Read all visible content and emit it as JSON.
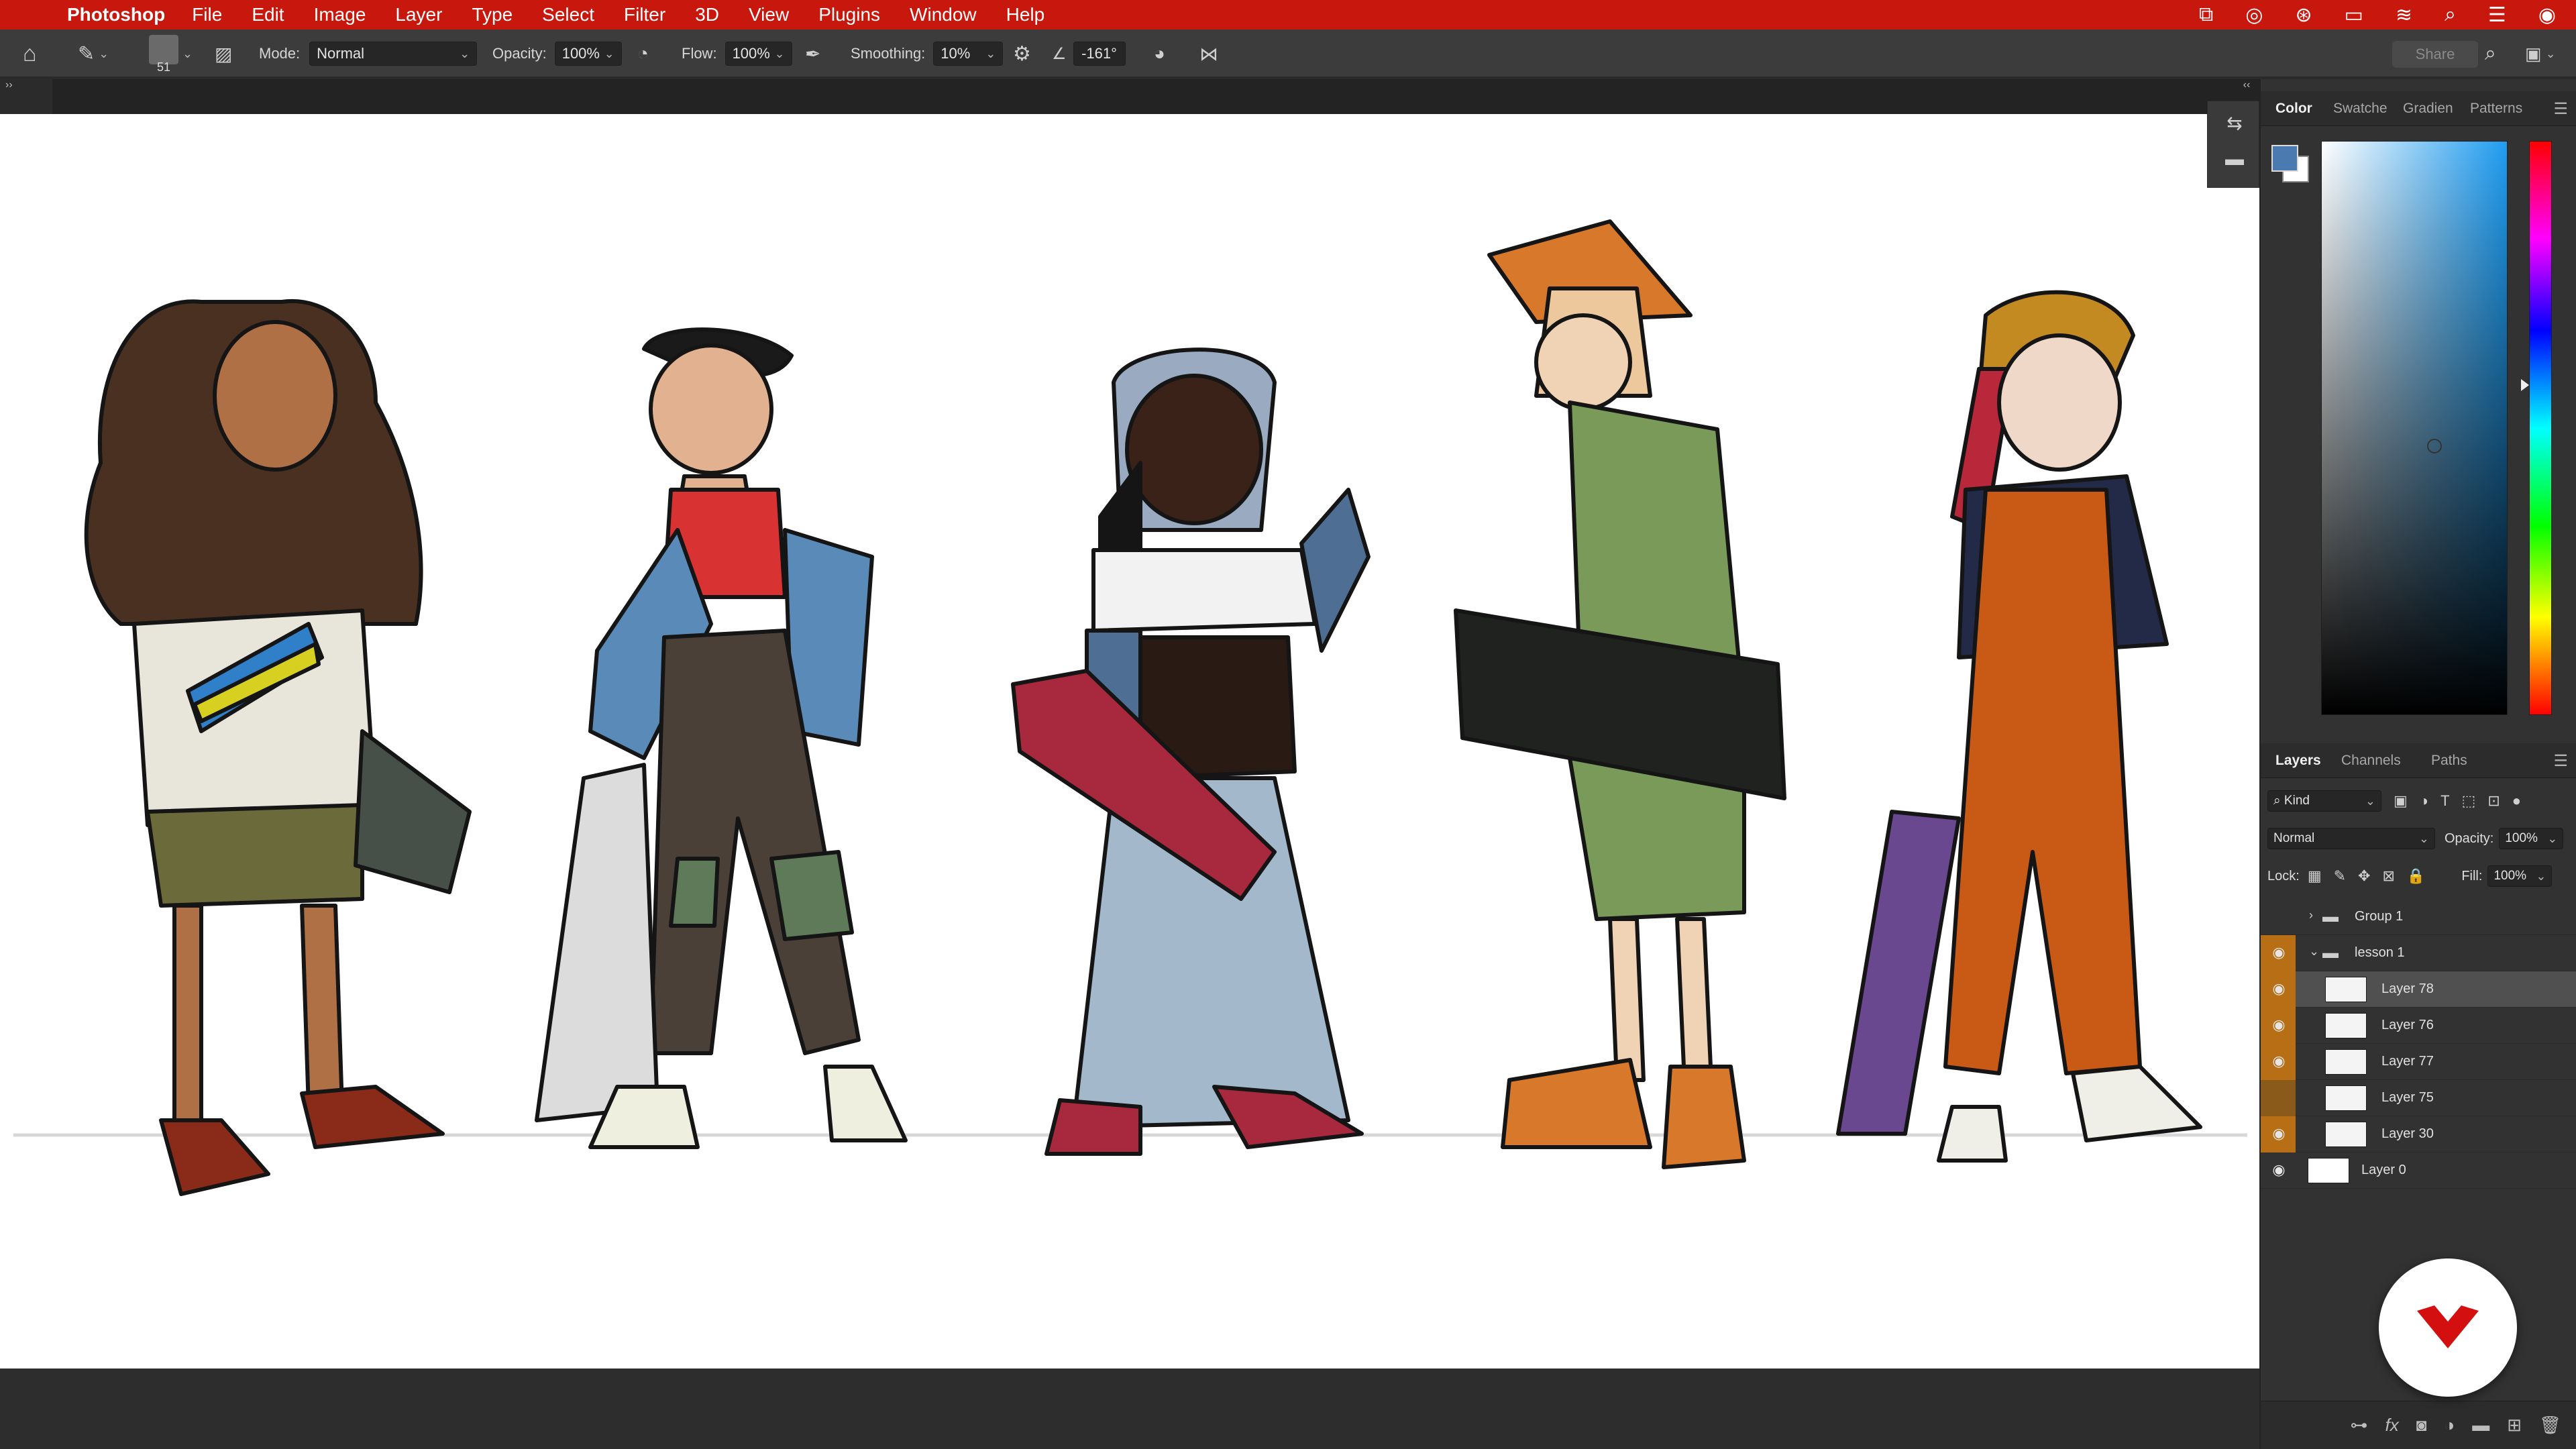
{
  "menubar": {
    "app_name": "Photoshop",
    "items": [
      "File",
      "Edit",
      "Image",
      "Layer",
      "Type",
      "Select",
      "Filter",
      "3D",
      "View",
      "Plugins",
      "Window",
      "Help"
    ],
    "color": "#c8170d"
  },
  "options": {
    "brush_size": "51",
    "mode_label": "Mode:",
    "mode_value": "Normal",
    "opacity_label": "Opacity:",
    "opacity_value": "100%",
    "flow_label": "Flow:",
    "flow_value": "100%",
    "smoothing_label": "Smoothing:",
    "smoothing_value": "10%",
    "angle_value": "-161°",
    "share_label": "Share"
  },
  "toolbar": {
    "tools": [
      "move-tool",
      "marquee-tool",
      "lasso-tool",
      "magic-wand-tool",
      "crop-tool",
      "frame-tool",
      "eyedropper-tool",
      "healing-tool",
      "brush-tool",
      "stamp-tool",
      "history-brush-tool",
      "eraser-tool",
      "gradient-tool",
      "blur-tool",
      "dodge-tool",
      "pen-tool",
      "type-tool",
      "path-select-tool",
      "rectangle-tool",
      "hand-tool",
      "zoom-tool",
      "more-tools"
    ],
    "foreground_color": "#4a7ab0",
    "background_color": "#ffffff"
  },
  "color_panel": {
    "tabs": [
      "Color",
      "Swatche",
      "Gradien",
      "Patterns"
    ],
    "active_tab": "Color"
  },
  "layers_panel": {
    "tabs": [
      "Layers",
      "Channels",
      "Paths"
    ],
    "kind_label": "Kind",
    "blend_mode": "Normal",
    "opacity_label": "Opacity:",
    "opacity_value": "100%",
    "lock_label": "Lock:",
    "fill_label": "Fill:",
    "fill_value": "100%",
    "layers": [
      {
        "name": "Group 1",
        "type": "group",
        "expanded": false,
        "visible": false,
        "selected": false
      },
      {
        "name": "lesson 1",
        "type": "group",
        "expanded": true,
        "visible": true,
        "selected": false
      },
      {
        "name": "Layer 78",
        "type": "layer",
        "visible": true,
        "selected": true
      },
      {
        "name": "Layer 76",
        "type": "layer",
        "visible": true,
        "selected": false
      },
      {
        "name": "Layer 77",
        "type": "layer",
        "visible": true,
        "selected": false
      },
      {
        "name": "Layer 75",
        "type": "layer",
        "visible": false,
        "selected": false
      },
      {
        "name": "Layer 30",
        "type": "layer",
        "visible": true,
        "selected": false
      },
      {
        "name": "Layer 0",
        "type": "layer",
        "visible": true,
        "selected": false
      }
    ]
  },
  "canvas": {
    "characters": [
      "curly-hair-girl",
      "cropped-top-boy",
      "hooded-skater",
      "bucket-hat-skater",
      "overalls-girl"
    ]
  }
}
